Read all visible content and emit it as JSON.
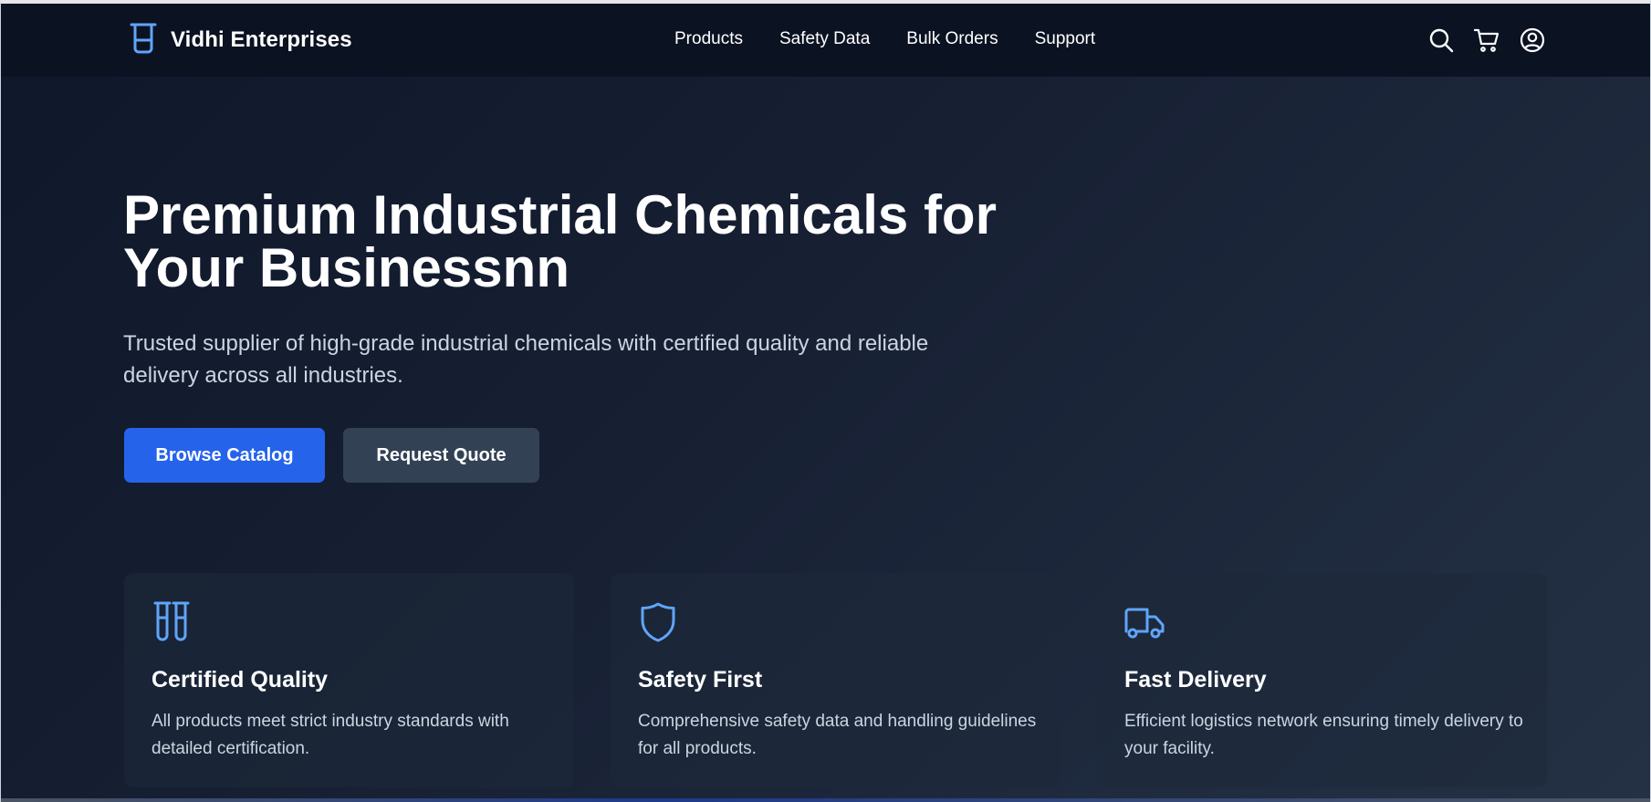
{
  "header": {
    "brand_name": "Vidhi Enterprises",
    "brand_icon": "beaker-icon",
    "nav": [
      "Products",
      "Safety Data",
      "Bulk Orders",
      "Support"
    ],
    "icons": [
      "search-icon",
      "cart-icon",
      "user-icon"
    ]
  },
  "hero": {
    "title": "Premium Industrial Chemicals for Your Businessnn",
    "subtitle": "Trusted supplier of high-grade industrial chemicals with certified quality and reliable delivery across all industries.",
    "primary_button": "Browse Catalog",
    "secondary_button": "Request Quote"
  },
  "features": [
    {
      "icon": "test-tubes-icon",
      "title": "Certified Quality",
      "text": "All products meet strict industry standards with detailed certification."
    },
    {
      "icon": "shield-icon",
      "title": "Safety First",
      "text": "Comprehensive safety data and handling guidelines for all products."
    },
    {
      "icon": "truck-icon",
      "title": "Fast Delivery",
      "text": "Efficient logistics network ensuring timely delivery to your facility."
    }
  ],
  "colors": {
    "background": "#0f172a",
    "header": "#0b1222",
    "accent": "#2563eb",
    "icon_accent": "#60a5fa",
    "secondary_button": "#334155",
    "muted_text": "#cbd5e1"
  }
}
